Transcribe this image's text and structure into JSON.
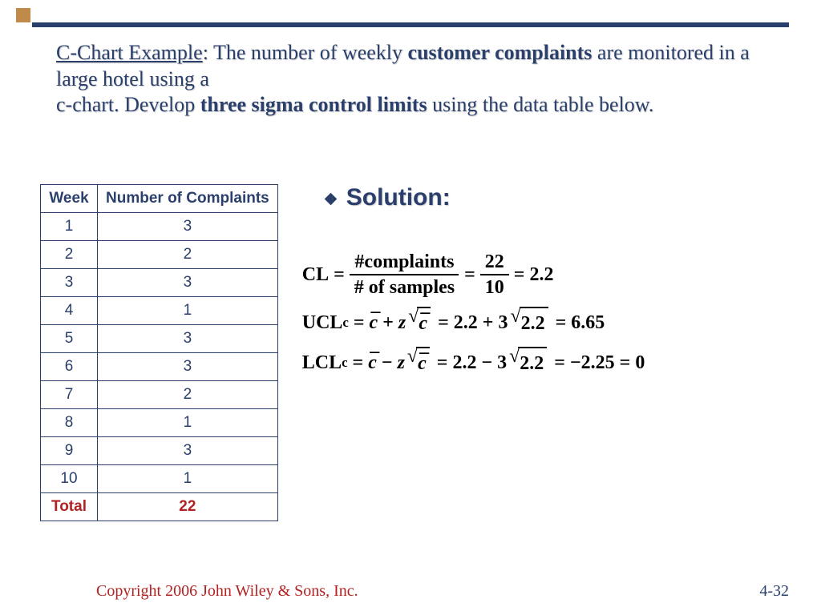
{
  "title": {
    "lead": "C-Chart Example",
    "b1": "customer complaints",
    "b2": "three sigma control limits",
    "t1": ": The number of weekly ",
    "t2": " are monitored in a large hotel using a ",
    "t3": "c-chart. Develop ",
    "t4": " using the data table below."
  },
  "table": {
    "headers": [
      "Week",
      "Number of Complaints"
    ],
    "rows": [
      [
        "1",
        "3"
      ],
      [
        "2",
        "2"
      ],
      [
        "3",
        "3"
      ],
      [
        "4",
        "1"
      ],
      [
        "5",
        "3"
      ],
      [
        "6",
        "3"
      ],
      [
        "7",
        "2"
      ],
      [
        "8",
        "1"
      ],
      [
        "9",
        "3"
      ],
      [
        "10",
        "1"
      ]
    ],
    "total_label": "Total",
    "total_value": "22"
  },
  "solution": {
    "heading": "Solution:",
    "cl_label": "CL",
    "eq": "=",
    "frac1_num": "#complaints",
    "frac1_den": "# of samples",
    "frac2_num": "22",
    "frac2_den": "10",
    "cl_result": "2.2",
    "ucl_label": "UCL",
    "lcl_label": "LCL",
    "sub_c": "c",
    "cbar": "c",
    "plus": "+",
    "minus": "−",
    "z": "z",
    "ucl_expr_a": "2.2",
    "ucl_expr_b": "3",
    "sqrt_arg": "2.2",
    "ucl_result": "6.65",
    "lcl_result_raw": "−2.25",
    "lcl_result": "0"
  },
  "footer": {
    "copyright": "Copyright 2006 John Wiley & Sons, Inc.",
    "page": "4-32"
  },
  "chart_data": {
    "type": "table",
    "title": "C-Chart Example: weekly customer complaints",
    "categories": [
      "1",
      "2",
      "3",
      "4",
      "5",
      "6",
      "7",
      "8",
      "9",
      "10"
    ],
    "values": [
      3,
      2,
      3,
      1,
      3,
      3,
      2,
      1,
      3,
      1
    ],
    "total": 22,
    "n_samples": 10,
    "CL": 2.2,
    "UCL": 6.65,
    "LCL_raw": -2.25,
    "LCL": 0,
    "z": 3,
    "xlabel": "Week",
    "ylabel": "Number of Complaints"
  }
}
